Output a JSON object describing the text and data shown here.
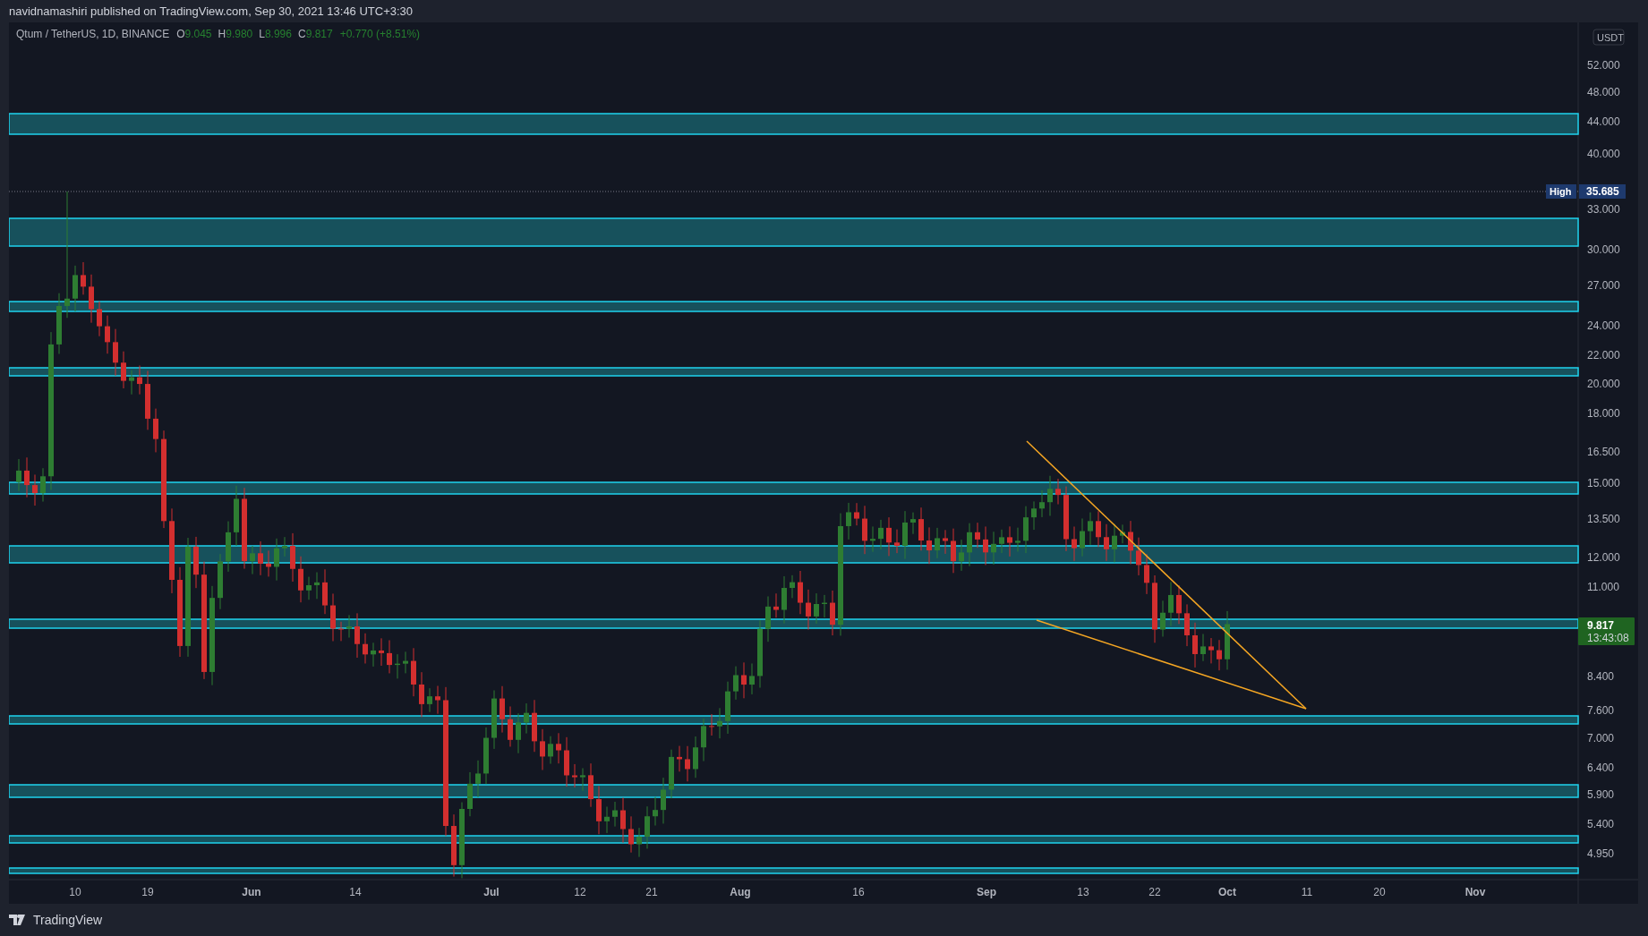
{
  "publication": {
    "text": "navidnamashiri published on TradingView.com, Sep 30, 2021 13:46 UTC+3:30"
  },
  "legend": {
    "symbol": "Qtum / TetherUS, 1D, BINANCE",
    "readings": [
      {
        "label": "O",
        "value": "9.045"
      },
      {
        "label": "H",
        "value": "9.980"
      },
      {
        "label": "L",
        "value": "8.996"
      },
      {
        "label": "C",
        "value": "9.817"
      }
    ],
    "change": "+0.770 (+8.51%)"
  },
  "price_axis": {
    "currency": "USDT",
    "labels": [
      "52.000",
      "48.000",
      "44.000",
      "40.000",
      "33.000",
      "30.000",
      "27.000",
      "24.000",
      "22.000",
      "20.000",
      "18.000",
      "16.500",
      "15.000",
      "13.500",
      "12.000",
      "11.000",
      "8.400",
      "7.600",
      "7.000",
      "6.400",
      "5.900",
      "5.400",
      "4.950"
    ],
    "high": {
      "label": "High",
      "value": "35.685"
    },
    "last": {
      "price": "9.817",
      "countdown": "13:43:08"
    }
  },
  "time_axis": {
    "labels": [
      "10",
      "19",
      "Jun",
      "14",
      "Jul",
      "12",
      "21",
      "Aug",
      "16",
      "Sep",
      "13",
      "22",
      "Oct",
      "11",
      "20",
      "Nov"
    ]
  },
  "footer": {
    "brand": "TradingView"
  }
}
